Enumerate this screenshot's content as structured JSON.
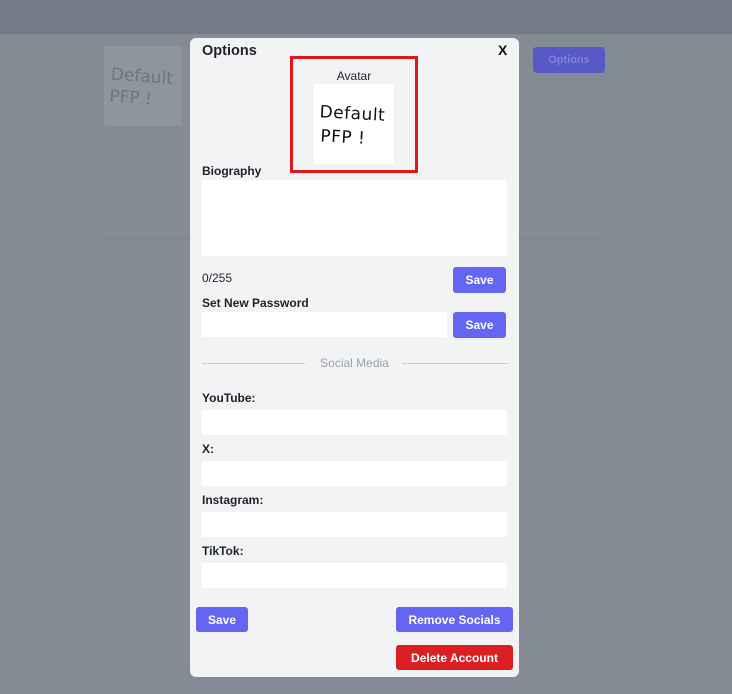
{
  "background": {
    "avatar_text": "Default PFP !",
    "options_button": "Options"
  },
  "modal": {
    "title": "Options",
    "close_label": "X",
    "avatar": {
      "label": "Avatar",
      "image_text_line1": "Default",
      "image_text_line2": "PFP !"
    },
    "biography": {
      "label": "Biography",
      "value": "",
      "counter": "0/255",
      "save_label": "Save"
    },
    "password": {
      "label": "Set New Password",
      "value": "",
      "save_label": "Save"
    },
    "social_divider": "Social Media",
    "socials": {
      "youtube_label": "YouTube:",
      "x_label": "X:",
      "instagram_label": "Instagram:",
      "tiktok_label": "TikTok:"
    },
    "actions": {
      "save_label": "Save",
      "remove_socials_label": "Remove Socials",
      "delete_account_label": "Delete Account"
    }
  },
  "colors": {
    "accent": "#6466f1",
    "danger": "#dc1f23",
    "highlight_border": "#e0161b",
    "overlay": "#858b95"
  }
}
